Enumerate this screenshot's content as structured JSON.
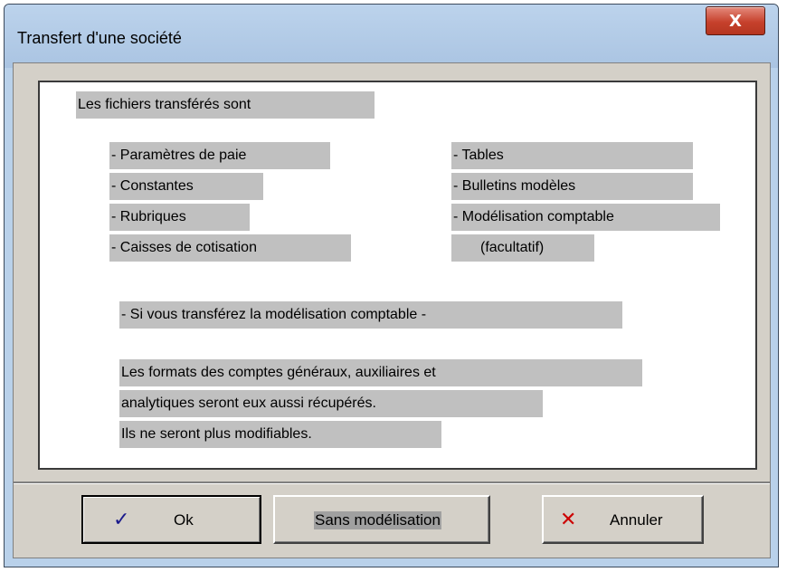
{
  "window": {
    "title": "Transfert d'une société",
    "close_glyph": "X"
  },
  "content": {
    "intro": "Les fichiers transférés sont",
    "left_list": [
      "- Paramètres de paie",
      "- Constantes",
      "- Rubriques",
      "- Caisses de cotisation"
    ],
    "right_list": [
      "- Tables",
      "- Bulletins modèles",
      "- Modélisation comptable",
      "(facultatif)"
    ],
    "warning_heading": "- Si vous transférez la modélisation comptable -",
    "warning_lines": [
      "Les formats des comptes généraux, auxiliaires et",
      "analytiques seront eux aussi récupérés.",
      "Ils ne seront plus modifiables."
    ]
  },
  "buttons": {
    "ok": {
      "label": "Ok",
      "icon": "checkmark-icon",
      "icon_glyph": "✓",
      "icon_color": "#1a1a8c"
    },
    "sans": {
      "label": "Sans modélisation"
    },
    "cancel": {
      "label": "Annuler",
      "icon": "cross-icon",
      "icon_glyph": "✕",
      "icon_color": "#cc0000"
    }
  },
  "colors": {
    "title_bar": "#b9d1ea",
    "dialog_bg": "#d4d0c8",
    "label_bg": "#c0c0c0",
    "close_button": "#c6412c"
  }
}
